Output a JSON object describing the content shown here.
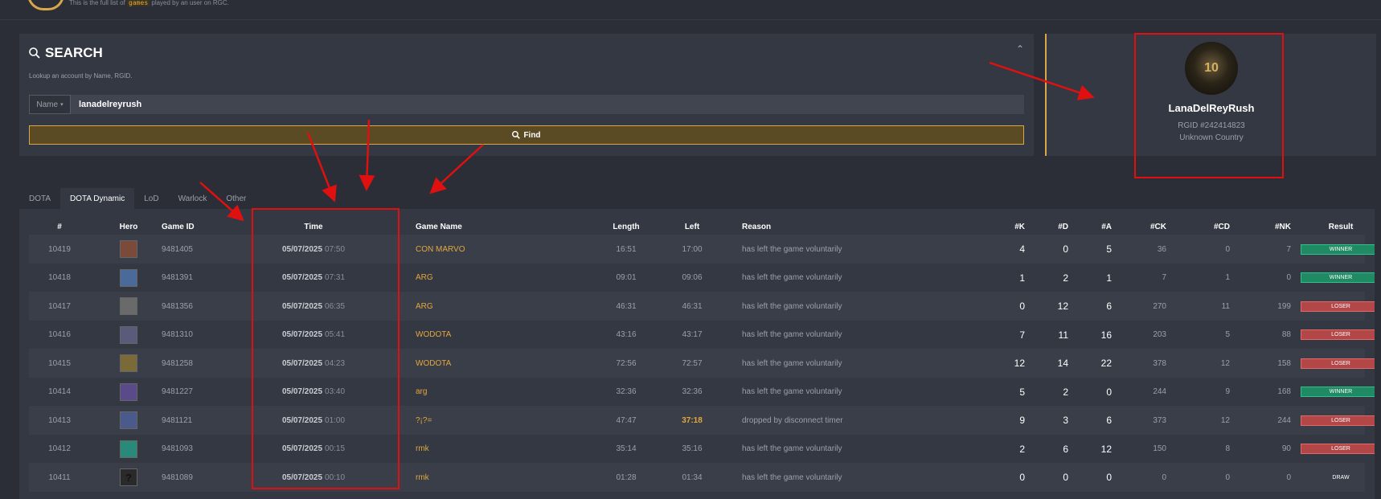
{
  "header": {
    "subtitle_pre": "This is the full list of",
    "subtitle_kw": "games",
    "subtitle_post": "played by an user on RGC."
  },
  "search": {
    "title": "SEARCH",
    "description": "Lookup an account by Name, RGID.",
    "type_label": "Name",
    "query": "lanadelreyrush",
    "find_label": "Find"
  },
  "profile": {
    "name": "LanaDelReyRush",
    "rgid": "RGID #242414823",
    "country": "Unknown Country",
    "avatar_text": "10"
  },
  "tabs": [
    {
      "label": "DOTA",
      "active": false
    },
    {
      "label": "DOTA Dynamic",
      "active": true
    },
    {
      "label": "LoD",
      "active": false
    },
    {
      "label": "Warlock",
      "active": false
    },
    {
      "label": "Other",
      "active": false
    }
  ],
  "columns": {
    "num": "#",
    "hero": "Hero",
    "game_id": "Game ID",
    "time": "Time",
    "game_name": "Game Name",
    "length": "Length",
    "left": "Left",
    "reason": "Reason",
    "k": "#K",
    "d": "#D",
    "a": "#A",
    "ck": "#CK",
    "cd": "#CD",
    "nk": "#NK",
    "result": "Result"
  },
  "rows": [
    {
      "num": "10419",
      "hero_icon": "hero-portrait-icon",
      "hero_color": "#7a4a3a",
      "game_id": "9481405",
      "date": "05/07/2025",
      "time": "07:50",
      "game_name": "CON MARVO",
      "length": "16:51",
      "left": "17:00",
      "left_hl": false,
      "reason": "has left the game voluntarily",
      "k": "4",
      "d": "0",
      "a": "5",
      "ck": "36",
      "cd": "0",
      "nk": "7",
      "result": "WINNER",
      "result_type": "winner"
    },
    {
      "num": "10418",
      "hero_icon": "hero-portrait-icon",
      "hero_color": "#4a6a9a",
      "game_id": "9481391",
      "date": "05/07/2025",
      "time": "07:31",
      "game_name": "ARG",
      "length": "09:01",
      "left": "09:06",
      "left_hl": false,
      "reason": "has left the game voluntarily",
      "k": "1",
      "d": "2",
      "a": "1",
      "ck": "7",
      "cd": "1",
      "nk": "0",
      "result": "WINNER",
      "result_type": "winner"
    },
    {
      "num": "10417",
      "hero_icon": "hero-portrait-icon",
      "hero_color": "#6a6a6a",
      "game_id": "9481356",
      "date": "05/07/2025",
      "time": "06:35",
      "game_name": "ARG",
      "length": "46:31",
      "left": "46:31",
      "left_hl": false,
      "reason": "has left the game voluntarily",
      "k": "0",
      "d": "12",
      "a": "6",
      "ck": "270",
      "cd": "11",
      "nk": "199",
      "result": "LOSER",
      "result_type": "loser"
    },
    {
      "num": "10416",
      "hero_icon": "hero-portrait-icon",
      "hero_color": "#5a5a7a",
      "game_id": "9481310",
      "date": "05/07/2025",
      "time": "05:41",
      "game_name": "WODOTA",
      "length": "43:16",
      "left": "43:17",
      "left_hl": false,
      "reason": "has left the game voluntarily",
      "k": "7",
      "d": "11",
      "a": "16",
      "ck": "203",
      "cd": "5",
      "nk": "88",
      "result": "LOSER",
      "result_type": "loser"
    },
    {
      "num": "10415",
      "hero_icon": "hero-portrait-icon",
      "hero_color": "#7a6a3a",
      "game_id": "9481258",
      "date": "05/07/2025",
      "time": "04:23",
      "game_name": "WODOTA",
      "length": "72:56",
      "left": "72:57",
      "left_hl": false,
      "reason": "has left the game voluntarily",
      "k": "12",
      "d": "14",
      "a": "22",
      "ck": "378",
      "cd": "12",
      "nk": "158",
      "result": "LOSER",
      "result_type": "loser"
    },
    {
      "num": "10414",
      "hero_icon": "hero-portrait-icon",
      "hero_color": "#5a4a8a",
      "game_id": "9481227",
      "date": "05/07/2025",
      "time": "03:40",
      "game_name": "arg",
      "length": "32:36",
      "left": "32:36",
      "left_hl": false,
      "reason": "has left the game voluntarily",
      "k": "5",
      "d": "2",
      "a": "0",
      "ck": "244",
      "cd": "9",
      "nk": "168",
      "result": "WINNER",
      "result_type": "winner"
    },
    {
      "num": "10413",
      "hero_icon": "hero-portrait-icon",
      "hero_color": "#4a5a8a",
      "game_id": "9481121",
      "date": "05/07/2025",
      "time": "01:00",
      "game_name": "?¡?=",
      "length": "47:47",
      "left": "37:18",
      "left_hl": true,
      "reason": "dropped by disconnect timer",
      "k": "9",
      "d": "3",
      "a": "6",
      "ck": "373",
      "cd": "12",
      "nk": "244",
      "result": "LOSER",
      "result_type": "loser"
    },
    {
      "num": "10412",
      "hero_icon": "hero-portrait-icon",
      "hero_color": "#2a8a7a",
      "game_id": "9481093",
      "date": "05/07/2025",
      "time": "00:15",
      "game_name": "rmk",
      "length": "35:14",
      "left": "35:16",
      "left_hl": false,
      "reason": "has left the game voluntarily",
      "k": "2",
      "d": "6",
      "a": "12",
      "ck": "150",
      "cd": "8",
      "nk": "90",
      "result": "LOSER",
      "result_type": "loser"
    },
    {
      "num": "10411",
      "hero_icon": "unknown-hero-icon",
      "hero_color": "#2a2a2a",
      "hero_text": "?",
      "game_id": "9481089",
      "date": "05/07/2025",
      "time": "00:10",
      "game_name": "rmk",
      "length": "01:28",
      "left": "01:34",
      "left_hl": false,
      "reason": "has left the game voluntarily",
      "k": "0",
      "d": "0",
      "a": "0",
      "ck": "0",
      "cd": "0",
      "nk": "0",
      "result": "DRAW",
      "result_type": "draw"
    }
  ],
  "colors": {
    "accent": "#d9a64a",
    "winner": "#1f8a63",
    "loser": "#b34747",
    "annotation": "#e01010"
  }
}
